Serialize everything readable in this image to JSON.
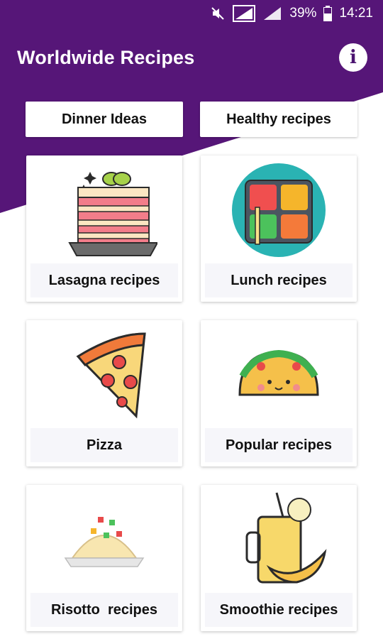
{
  "colors": {
    "primary": "#561678",
    "card_label_bg": "#f6f6fa"
  },
  "statusbar": {
    "battery": "39%",
    "time": "14:21",
    "icons": [
      "mute-icon",
      "no-sim-icon",
      "signal-icon",
      "battery-icon"
    ]
  },
  "appbar": {
    "title": "Worldwide Recipes",
    "info_icon": "info-icon"
  },
  "quick_buttons": {
    "dinner": "Dinner Ideas",
    "healthy": "Healthy recipes"
  },
  "cards": [
    {
      "label": "Lasagna recipes",
      "icon": "lasagna-icon"
    },
    {
      "label": "Lunch recipes",
      "icon": "lunch-box-icon"
    },
    {
      "label": "Pizza",
      "icon": "pizza-icon"
    },
    {
      "label": "Popular recipes",
      "icon": "taco-icon"
    },
    {
      "label": "Risotto  recipes",
      "icon": "risotto-icon"
    },
    {
      "label": "Smoothie recipes",
      "icon": "smoothie-icon"
    }
  ]
}
